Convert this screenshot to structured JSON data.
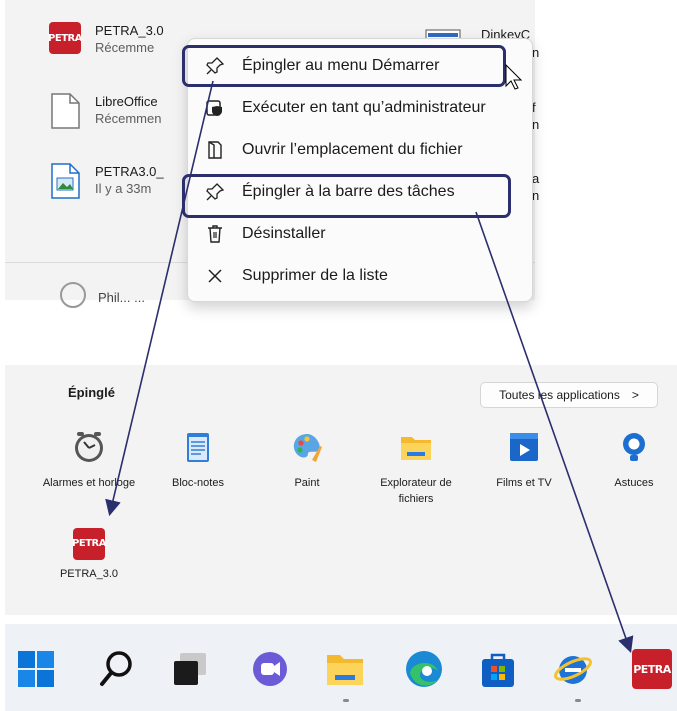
{
  "recent_items": [
    {
      "name": "PETRA_3.0",
      "sub": "Récemme",
      "icon": "petra-app-icon"
    },
    {
      "name": "LibreOffice",
      "sub": "Récemmen",
      "icon": "document-file-icon"
    },
    {
      "name": "PETRA3.0_",
      "sub": "Il y a 33m",
      "icon": "image-document-icon"
    }
  ],
  "right_peek": {
    "name": "DinkeyC",
    "a": "n",
    "b": "f",
    "c": "n",
    "d": "a",
    "e": "n"
  },
  "context_menu": {
    "items": [
      {
        "label": "Épingler au menu Démarrer",
        "icon": "pin-icon"
      },
      {
        "label": "Exécuter en tant qu’administrateur",
        "icon": "shield-admin-icon"
      },
      {
        "label": "Ouvrir l’emplacement du fichier",
        "icon": "folder-open-icon"
      },
      {
        "label": "Épingler à la barre des tâches",
        "icon": "pin-icon"
      },
      {
        "label": "Désinstaller",
        "icon": "trash-icon"
      },
      {
        "label": "Supprimer de la liste",
        "icon": "close-x-icon"
      }
    ],
    "highlighted": [
      "Épingler au menu Démarrer",
      "Épingler à la barre des tâches"
    ]
  },
  "partial_user_text": "Phil... ...",
  "pinned": {
    "title": "Épinglé",
    "all_apps_button": "Toutes les applications",
    "all_apps_chevron": ">",
    "apps": [
      {
        "label": "Alarmes et horloge",
        "icon": "alarm-clock-icon"
      },
      {
        "label": "Bloc-notes",
        "icon": "notepad-icon"
      },
      {
        "label": "Paint",
        "icon": "paint-palette-icon"
      },
      {
        "label": "Explorateur de fichiers",
        "icon": "file-explorer-folder-icon"
      },
      {
        "label": "Films et TV",
        "icon": "films-tv-icon"
      },
      {
        "label": "Astuces",
        "icon": "tips-lightbulb-icon"
      },
      {
        "label": "PETRA_3.0",
        "icon": "petra-app-icon"
      }
    ]
  },
  "petra_logo_text": "PETRA",
  "taskbar": {
    "icons": [
      "windows-start-icon",
      "search-icon",
      "task-view-icon",
      "teams-chat-icon",
      "file-explorer-icon",
      "edge-browser-icon",
      "microsoft-store-icon",
      "internet-explorer-icon",
      "petra-taskbar-icon"
    ]
  },
  "colors": {
    "highlight_border": "#2b2f6e",
    "arrow": "#2b2f6e",
    "petra_red": "#c8202b",
    "windows_blue": "#0a74d9"
  }
}
